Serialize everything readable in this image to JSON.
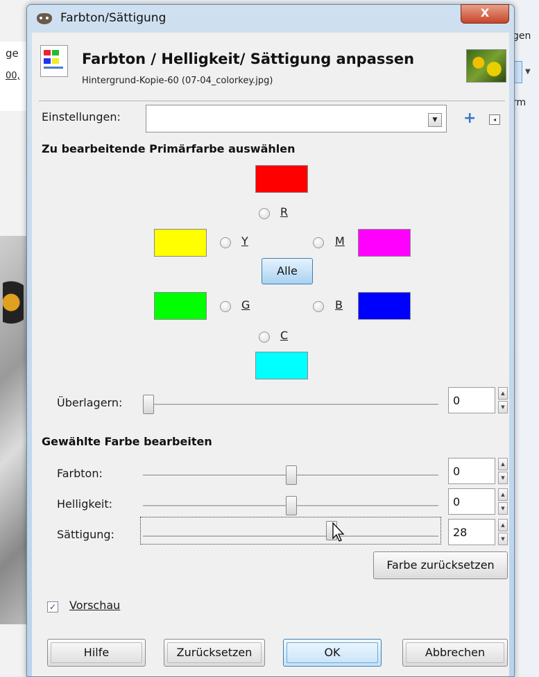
{
  "background": {
    "left_texts": [
      "ge",
      "00,"
    ],
    "right_texts": [
      "gen",
      "rm"
    ]
  },
  "window": {
    "title": "Farbton/Sättigung",
    "close_glyph": "X"
  },
  "header": {
    "title": "Farbton / Helligkeit/ Sättigung anpassen",
    "subtitle": "Hintergrund-Kopie-60 (07-04_colorkey.jpg)"
  },
  "presets": {
    "label": "Einstellungen:",
    "value": ""
  },
  "primary": {
    "heading": "Zu bearbeitende Primärfarbe auswählen",
    "radios": [
      {
        "label": "R",
        "color": "#ff0000"
      },
      {
        "label": "Y",
        "color": "#ffff00"
      },
      {
        "label": "M",
        "color": "#ff00ff"
      },
      {
        "label": "G",
        "color": "#00ff00"
      },
      {
        "label": "B",
        "color": "#0000ff"
      },
      {
        "label": "C",
        "color": "#00ffff"
      }
    ],
    "all_button": "Alle"
  },
  "overlap": {
    "label": "Überlagern:",
    "value": "0",
    "position": 0.0
  },
  "edit": {
    "heading": "Gewählte Farbe bearbeiten",
    "sliders": [
      {
        "label": "Farbton:",
        "value": "0",
        "position": 0.5
      },
      {
        "label": "Helligkeit:",
        "value": "0",
        "position": 0.5
      },
      {
        "label": "Sättigung:",
        "value": "28",
        "position": 0.64
      }
    ],
    "reset_color_button": "Farbe zurücksetzen"
  },
  "preview": {
    "label": "Vorschau",
    "checked": true
  },
  "buttons": {
    "help": "Hilfe",
    "reset": "Zurücksetzen",
    "ok": "OK",
    "cancel": "Abbrechen"
  },
  "colors": {
    "accent": "#3a78c8",
    "title_bar": "#c7dbed"
  }
}
